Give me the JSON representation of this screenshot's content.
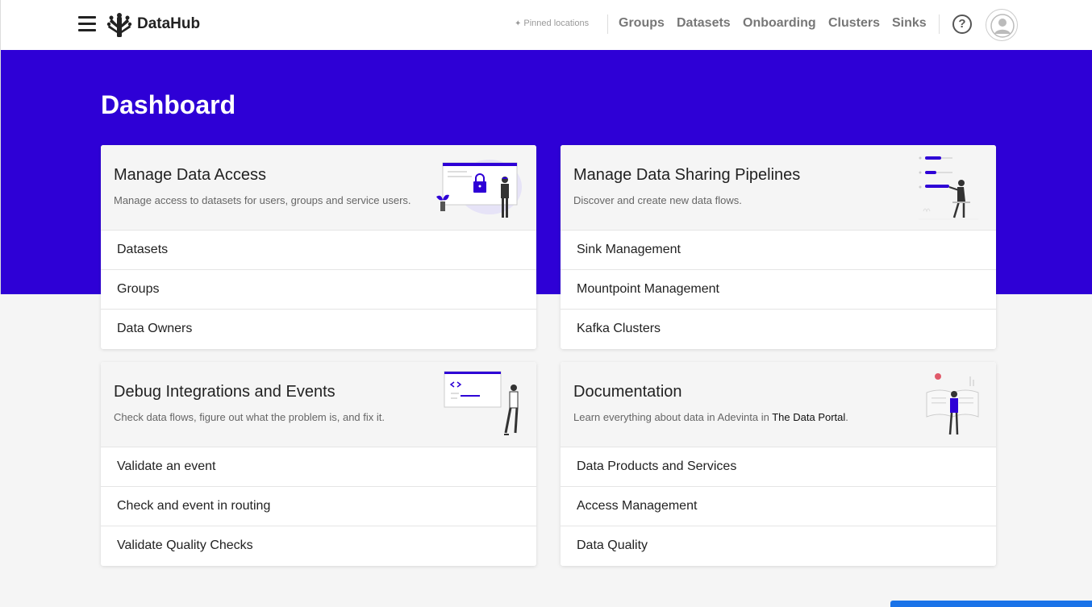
{
  "app": {
    "name": "DataHub"
  },
  "nav": {
    "pinned": "Pinned locations",
    "links": [
      "Groups",
      "Datasets",
      "Onboarding",
      "Clusters",
      "Sinks"
    ],
    "help": "?"
  },
  "page": {
    "title": "Dashboard"
  },
  "cards": [
    {
      "title": "Manage Data Access",
      "description": "Manage access to datasets for users, groups and service users.",
      "items": [
        "Datasets",
        "Groups",
        "Data Owners"
      ]
    },
    {
      "title": "Manage Data Sharing Pipelines",
      "description": "Discover and create new data flows.",
      "items": [
        "Sink Management",
        "Mountpoint Management",
        "Kafka Clusters"
      ]
    },
    {
      "title": "Debug Integrations and Events",
      "description": "Check data flows, figure out what the problem is, and fix it.",
      "items": [
        "Validate an event",
        "Check and event in routing",
        "Validate Quality Checks"
      ]
    },
    {
      "title": "Documentation",
      "description_prefix": "Learn everything about data in Adevinta in ",
      "description_link": "The Data Portal",
      "description_suffix": ".",
      "items": [
        "Data Products and Services",
        "Access Management",
        "Data Quality"
      ]
    }
  ],
  "colors": {
    "hero": "#2e00d6",
    "accent": "#1a73e8",
    "illustration": "#2e00d6"
  },
  "icons": [
    "menu-icon",
    "datahub-logo-icon",
    "pin-icon",
    "help-icon",
    "user-avatar-icon"
  ]
}
